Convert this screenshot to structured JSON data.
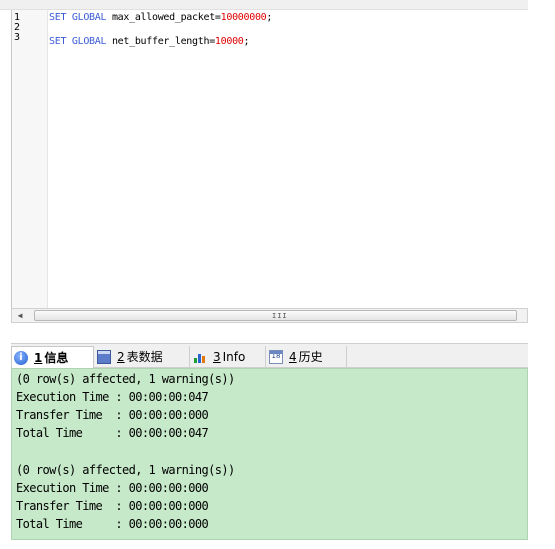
{
  "editor": {
    "line_numbers": [
      "1",
      "2",
      "3"
    ],
    "lines": [
      {
        "kw": "SET GLOBAL",
        "ident": " max_allowed_packet=",
        "num": "10000000",
        "end": ";"
      },
      {
        "kw": "",
        "ident": "",
        "num": "",
        "end": ""
      },
      {
        "kw": "SET GLOBAL",
        "ident": " net_buffer_length=",
        "num": "10000",
        "end": ";"
      }
    ]
  },
  "scrollbar": {
    "left_arrow": "◀",
    "grip": "III"
  },
  "tabs": [
    {
      "number": "1",
      "label": "信息",
      "icon": "info-icon"
    },
    {
      "number": "2",
      "label": "表数据",
      "icon": "table-data-icon"
    },
    {
      "number": "3",
      "label": "Info",
      "icon": "chart-info-icon"
    },
    {
      "number": "4",
      "label": "历史",
      "icon": "history-calendar-icon"
    }
  ],
  "calendar_icon_text": "18",
  "output": {
    "lines": [
      "(0 row(s) affected, 1 warning(s))",
      "Execution Time : 00:00:00:047",
      "Transfer Time  : 00:00:00:000",
      "Total Time     : 00:00:00:047",
      "",
      "(0 row(s) affected, 1 warning(s))",
      "Execution Time : 00:00:00:000",
      "Transfer Time  : 00:00:00:000",
      "Total Time     : 00:00:00:000"
    ]
  },
  "colors": {
    "keyword": "#3b5bd6",
    "number": "#e00000",
    "output_bg": "#c6e9c9"
  }
}
